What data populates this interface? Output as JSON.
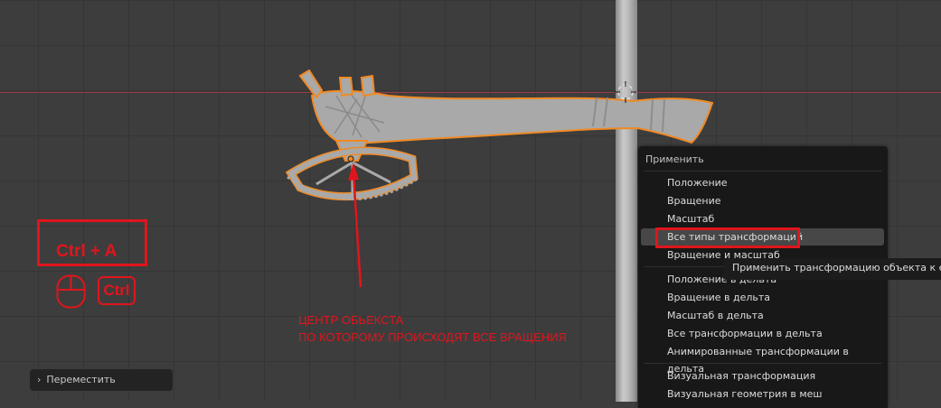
{
  "shortcut": {
    "keys": "Ctrl + A",
    "modifier_key": "Ctrl"
  },
  "annotation": {
    "line1": "ЦЕНТР ОБЬЕКСТА",
    "line2": "ПО КОТОРОМУ ПРОИСХОДЯТ ВСЕ ВРАЩЕНИЯ"
  },
  "operator_panel": {
    "label": "Переместить",
    "icon": "chevron-right-icon"
  },
  "apply_menu": {
    "title": "Применить",
    "items": [
      "Положение",
      "Вращение",
      "Масштаб",
      "Все типы трансформаций",
      "Вращение и масштаб",
      "Положение в дельта",
      "Вращение в дельта",
      "Масштаб в дельта",
      "Все трансформации в дельта",
      "Анимированные трансформации в дельта",
      "Визуальная трансформация",
      "Визуальная геометрия в меш"
    ],
    "hovered_item_index": 3
  },
  "tooltip": {
    "text": "Применить трансформацию объекта к его"
  },
  "colors": {
    "annotation_red": "#e0151c",
    "x_axis": "#9b3943",
    "selection_outline": "#f08a24",
    "viewport_bg": "#3d3d3d"
  }
}
